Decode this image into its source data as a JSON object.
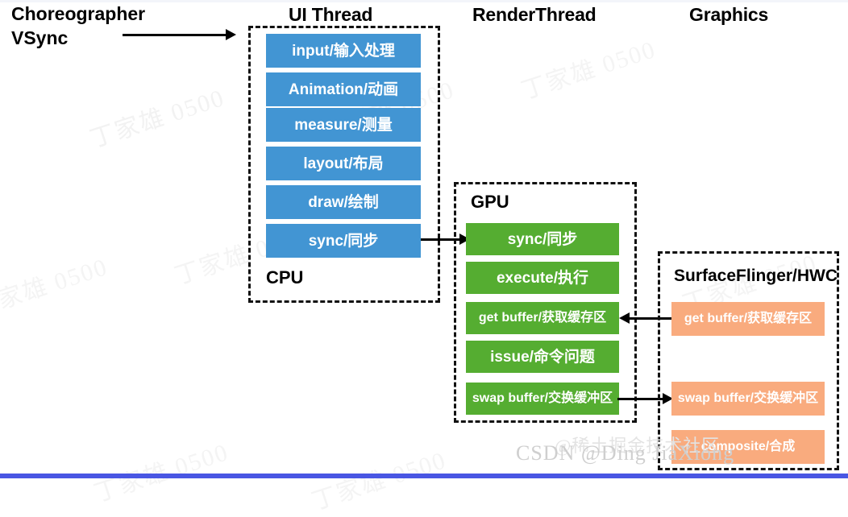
{
  "headers": {
    "choreographer": "Choreographer",
    "vsync": "VSync",
    "ui_thread": "UI Thread",
    "render_thread": "RenderThread",
    "graphics": "Graphics"
  },
  "containers": {
    "cpu_label": "CPU",
    "gpu_label": "GPU",
    "surfaceflinger_label": "SurfaceFlinger/HWC"
  },
  "ui_thread_steps": [
    {
      "label": "input/输入处理"
    },
    {
      "label": "Animation/动画"
    },
    {
      "label": "measure/测量"
    },
    {
      "label": "layout/布局"
    },
    {
      "label": "draw/绘制"
    },
    {
      "label": "sync/同步"
    }
  ],
  "gpu_steps": [
    {
      "label": "sync/同步"
    },
    {
      "label": "execute/执行"
    },
    {
      "label": "get buffer/获取缓存区"
    },
    {
      "label": "issue/命令问题"
    },
    {
      "label": "swap buffer/交换缓冲区"
    }
  ],
  "surfaceflinger_steps": [
    {
      "label": "get buffer/获取缓存区"
    },
    {
      "label": "swap buffer/交换缓冲区"
    },
    {
      "label": "composite/合成"
    }
  ],
  "watermarks": {
    "repeat_text": "丁家雄 0500",
    "bottom_csdn": "CSDN @Ding JiaXiong",
    "bottom_cn": "@稀土掘金技术社区"
  },
  "colors": {
    "blue": "#4295d3",
    "green": "#55ad31",
    "orange": "#f9ab7e",
    "dash": "#111111",
    "bottom_bar": "#4956e3"
  }
}
